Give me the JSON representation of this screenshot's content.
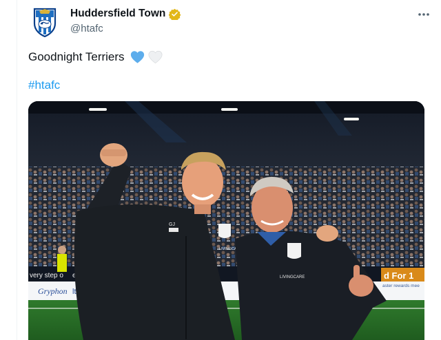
{
  "author": {
    "display_name": "Huddersfield Town",
    "handle": "@htafc",
    "verified": true,
    "avatar_icon": "club-crest-icon",
    "badge_color": "#e2b719"
  },
  "tweet": {
    "text": "Goodnight Terriers",
    "emojis": [
      "blue-heart-icon",
      "white-heart-icon"
    ],
    "hashtag": "#htafc",
    "link_color": "#1d9bf0"
  },
  "photo": {
    "banner_left": "very step o",
    "banner_left2": "egal",
    "banner_right": "d For 1",
    "board_left": "Gryphon",
    "board_left2": "ltamante",
    "board_right": "aster rewards mee",
    "jacket_sponsor": "LIVINGCARE",
    "jacket_initials": "GJ"
  }
}
